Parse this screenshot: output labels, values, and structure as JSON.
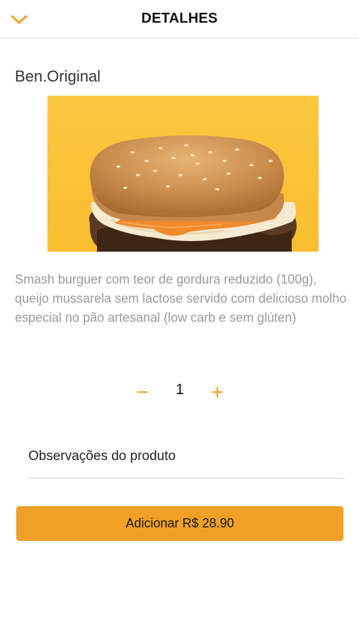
{
  "header": {
    "title": "DETALHES",
    "back_icon": "chevron-down-icon"
  },
  "product": {
    "name": "Ben.Original",
    "image_description_icon": "burger-photo",
    "description": "Smash burguer com teor de gordura reduzido (100g), queijo mussarela sem lactose servido com delicioso molho especial no pão artesanal (low carb e sem glúten)"
  },
  "quantity": {
    "minus_label": "−",
    "value": "1",
    "plus_label": "+"
  },
  "observations": {
    "label": "Observações do produto"
  },
  "add_button": {
    "label": "Adicionar R$ 28.90"
  },
  "colors": {
    "accent": "#f0a026",
    "image_bg": "#fbc53a",
    "text_muted": "#9a9a9a"
  }
}
